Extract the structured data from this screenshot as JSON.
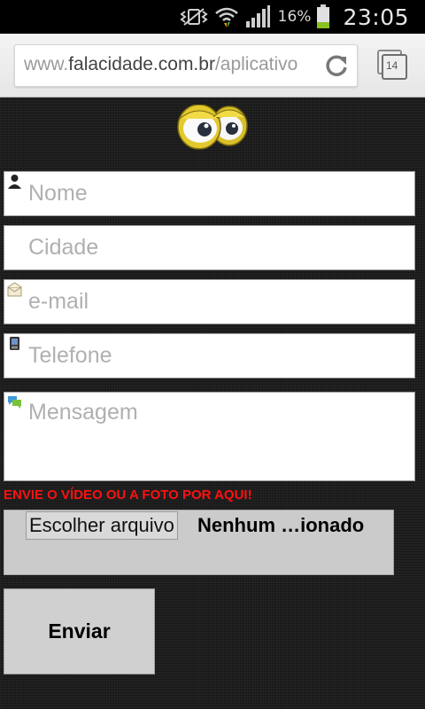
{
  "status_bar": {
    "battery_percent": "16%",
    "time": "23:05"
  },
  "browser": {
    "url_prefix": "www.",
    "url_domain": "falacidade.com.br",
    "url_path": "/aplicativo",
    "tab_count": "14"
  },
  "form": {
    "name_placeholder": "Nome",
    "city_placeholder": "Cidade",
    "email_placeholder": "e-mail",
    "phone_placeholder": "Telefone",
    "message_placeholder": "Mensagem",
    "upload_notice": "ENVIE O VÍDEO OU A FOTO POR AQUI!",
    "file_button_label": "Escolher arquivo",
    "file_status": "Nenhum …ionado",
    "submit_label": "Enviar"
  },
  "colors": {
    "warning_text": "#ff1010",
    "page_background": "#1f1f1f"
  }
}
